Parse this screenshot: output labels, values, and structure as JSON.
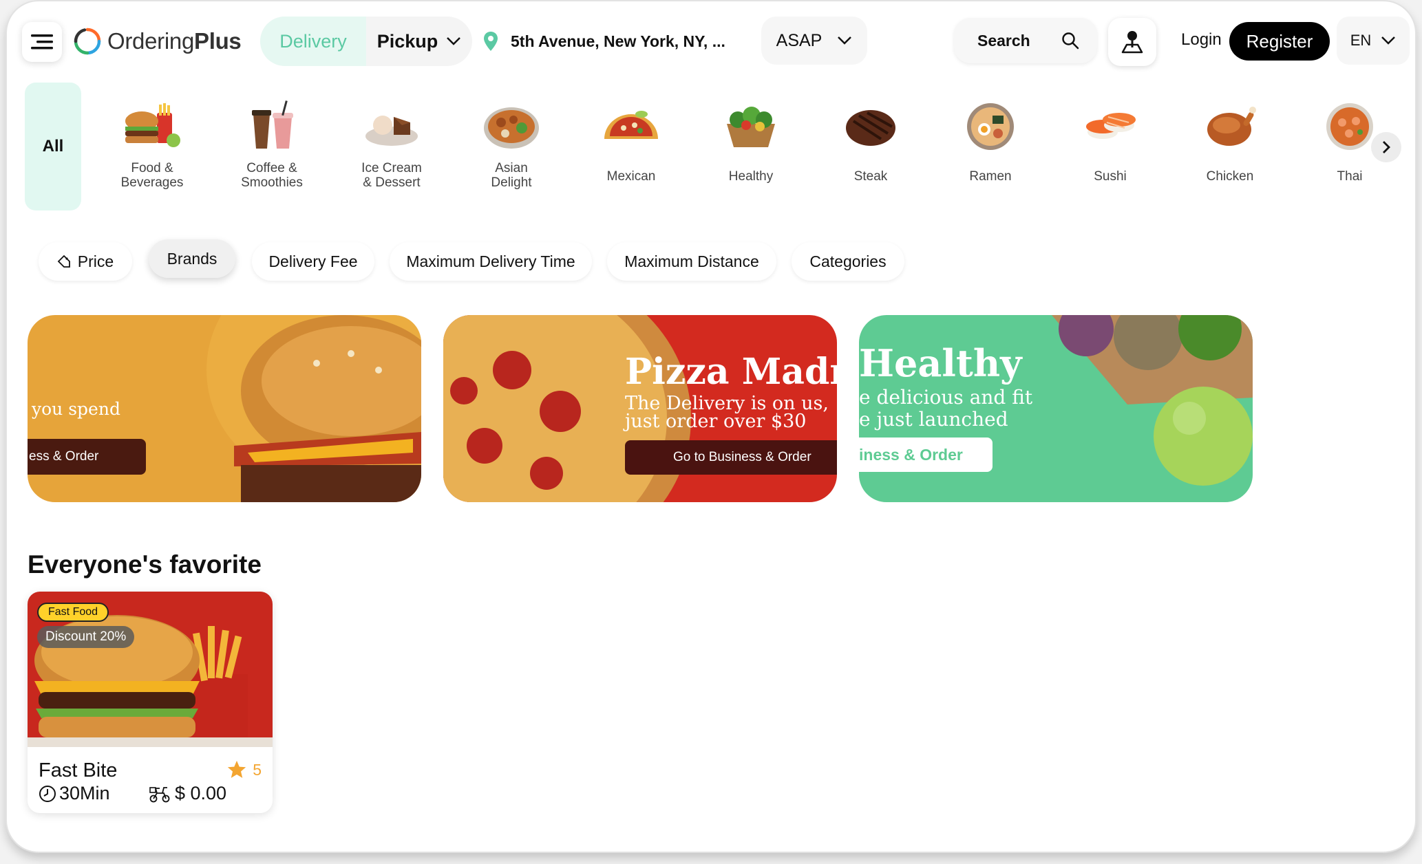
{
  "header": {
    "logo": {
      "part1": "Ordering",
      "part2": "Plus"
    },
    "mode": {
      "delivery": "Delivery",
      "pickup": "Pickup"
    },
    "address": "5th Avenue, New York, NY, ...",
    "time": "ASAP",
    "search_label": "Search",
    "login": "Login",
    "register": "Register",
    "language": "EN"
  },
  "categories": {
    "all": "All",
    "items": [
      {
        "label": "Food &\nBeverages",
        "icon": "burger-combo-icon"
      },
      {
        "label": "Coffee &\nSmoothies",
        "icon": "drinks-icon"
      },
      {
        "label": "Ice Cream\n& Dessert",
        "icon": "dessert-icon"
      },
      {
        "label": "Asian\nDelight",
        "icon": "rice-bowl-icon"
      },
      {
        "label": "Mexican",
        "icon": "taco-icon"
      },
      {
        "label": "Healthy",
        "icon": "salad-icon"
      },
      {
        "label": "Steak",
        "icon": "steak-icon"
      },
      {
        "label": "Ramen",
        "icon": "ramen-icon"
      },
      {
        "label": "Sushi",
        "icon": "sushi-icon"
      },
      {
        "label": "Chicken",
        "icon": "chicken-icon"
      },
      {
        "label": "Thai",
        "icon": "thai-dish-icon"
      }
    ]
  },
  "filters": [
    "Price",
    "Brands",
    "Delivery Fee",
    "Maximum Delivery Time",
    "Maximum Distance",
    "Categories"
  ],
  "banners": [
    {
      "subtitle": "you spend",
      "button": "ess & Order"
    },
    {
      "title": "Pizza Madn",
      "subtitle1": "The Delivery is on us,",
      "subtitle2": "just order over $30",
      "button": "Go to Business & Order"
    },
    {
      "title": "Healthy",
      "subtitle1": "e delicious and fit",
      "subtitle2": "e just launched",
      "button": "iness & Order"
    }
  ],
  "section_title": "Everyone's favorite",
  "business_card": {
    "tag": "Fast Food",
    "discount": "Discount 20%",
    "name": "Fast Bite",
    "rating": "5",
    "time": "30Min",
    "fee": "$ 0.00"
  },
  "colors": {
    "accent": "#5bc9a3",
    "accent_bg": "#e1f8f1",
    "star": "#f3a531"
  }
}
